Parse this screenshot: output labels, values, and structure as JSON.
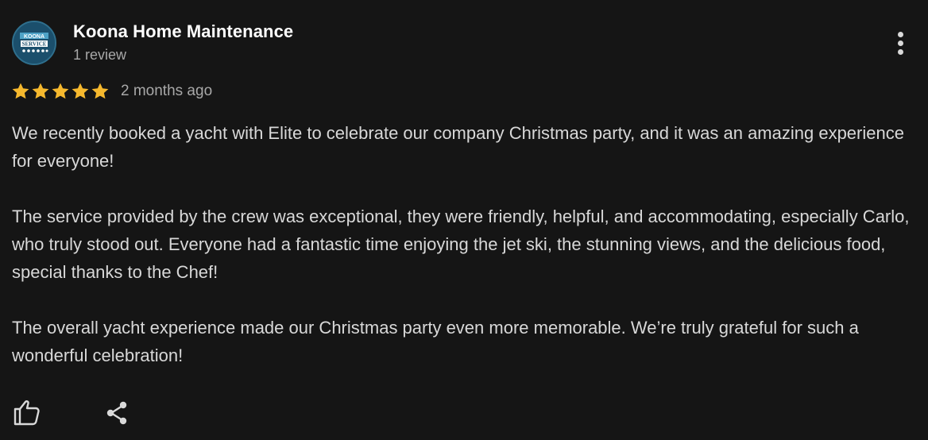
{
  "review": {
    "author_name": "Koona Home Maintenance",
    "review_count": "1 review",
    "rating": 5,
    "max_rating": 5,
    "date": "2 months ago",
    "paragraphs": [
      "We recently booked a yacht with Elite to celebrate our company Christmas party, and it was an amazing experience for everyone!",
      "The service provided by the crew was exceptional, they were friendly, helpful, and accommodating, especially Carlo, who truly stood out. Everyone had a fantastic time enjoying the jet ski, the stunning views, and the delicious food, special thanks to the Chef!",
      "The overall yacht experience made our Christmas party even more memorable. We’re truly grateful for such a wonderful celebration!"
    ],
    "avatar": {
      "text_top": "KOONA",
      "text_mid": "SERVICE"
    }
  },
  "icons": {
    "more": "more-vertical-icon",
    "like": "thumbs-up-icon",
    "share": "share-icon",
    "star": "star-icon"
  },
  "colors": {
    "background": "#151515",
    "star": "#f5b82e",
    "name": "#ffffff",
    "meta": "#a8a8a8",
    "body": "#d8d8d8",
    "avatar_bg": "#1b4f6c"
  }
}
